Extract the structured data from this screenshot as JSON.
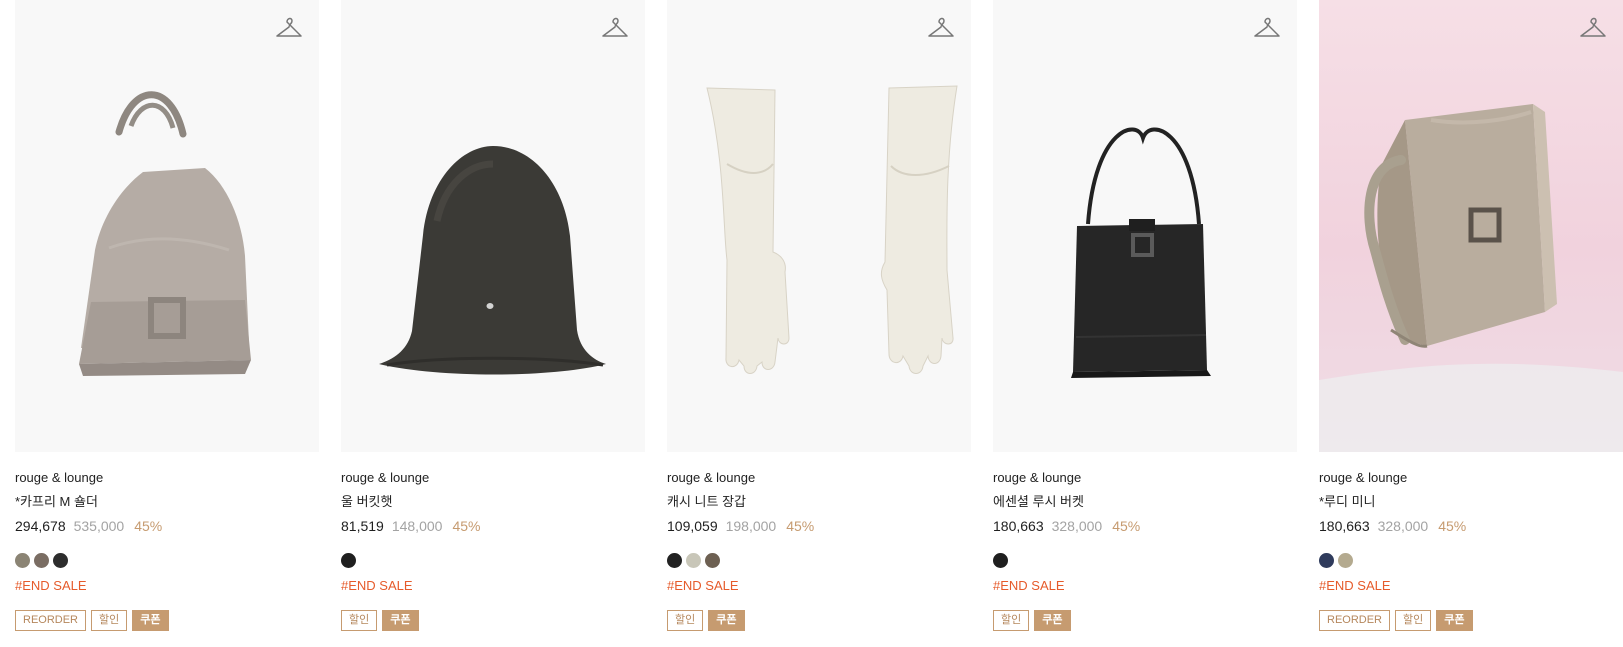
{
  "products": [
    {
      "image": "tote-shoulder-bag-image",
      "brand": "rouge & lounge",
      "name": "*카프리 M 숄더",
      "price": "294,678",
      "original_price": "535,000",
      "discount": "45%",
      "swatches": [
        "#8b8474",
        "#7a6d63",
        "#2d2d2d"
      ],
      "sale_label": "#END SALE",
      "tags": [
        "REORDER",
        "할인",
        "쿠폰"
      ]
    },
    {
      "image": "bucket-hat-image",
      "brand": "rouge & lounge",
      "name": "울 버킷햇",
      "price": "81,519",
      "original_price": "148,000",
      "discount": "45%",
      "swatches": [
        "#1f1f1f"
      ],
      "sale_label": "#END SALE",
      "tags": [
        "할인",
        "쿠폰"
      ]
    },
    {
      "image": "knit-gloves-image",
      "brand": "rouge & lounge",
      "name": "캐시 니트 장갑",
      "price": "109,059",
      "original_price": "198,000",
      "discount": "45%",
      "swatches": [
        "#222222",
        "#c8c6b8",
        "#6d6052"
      ],
      "sale_label": "#END SALE",
      "tags": [
        "할인",
        "쿠폰"
      ]
    },
    {
      "image": "bucket-bag-image",
      "brand": "rouge & lounge",
      "name": "에센셜 루시 버켓",
      "price": "180,663",
      "original_price": "328,000",
      "discount": "45%",
      "swatches": [
        "#1f1f1f"
      ],
      "sale_label": "#END SALE",
      "tags": [
        "할인",
        "쿠폰"
      ]
    },
    {
      "image": "mini-bag-image",
      "brand": "rouge & lounge",
      "name": "*루디 미니",
      "price": "180,663",
      "original_price": "328,000",
      "discount": "45%",
      "swatches": [
        "#2f3b5c",
        "#b4aa8f"
      ],
      "sale_label": "#END SALE",
      "tags": [
        "REORDER",
        "할인",
        "쿠폰"
      ]
    }
  ]
}
